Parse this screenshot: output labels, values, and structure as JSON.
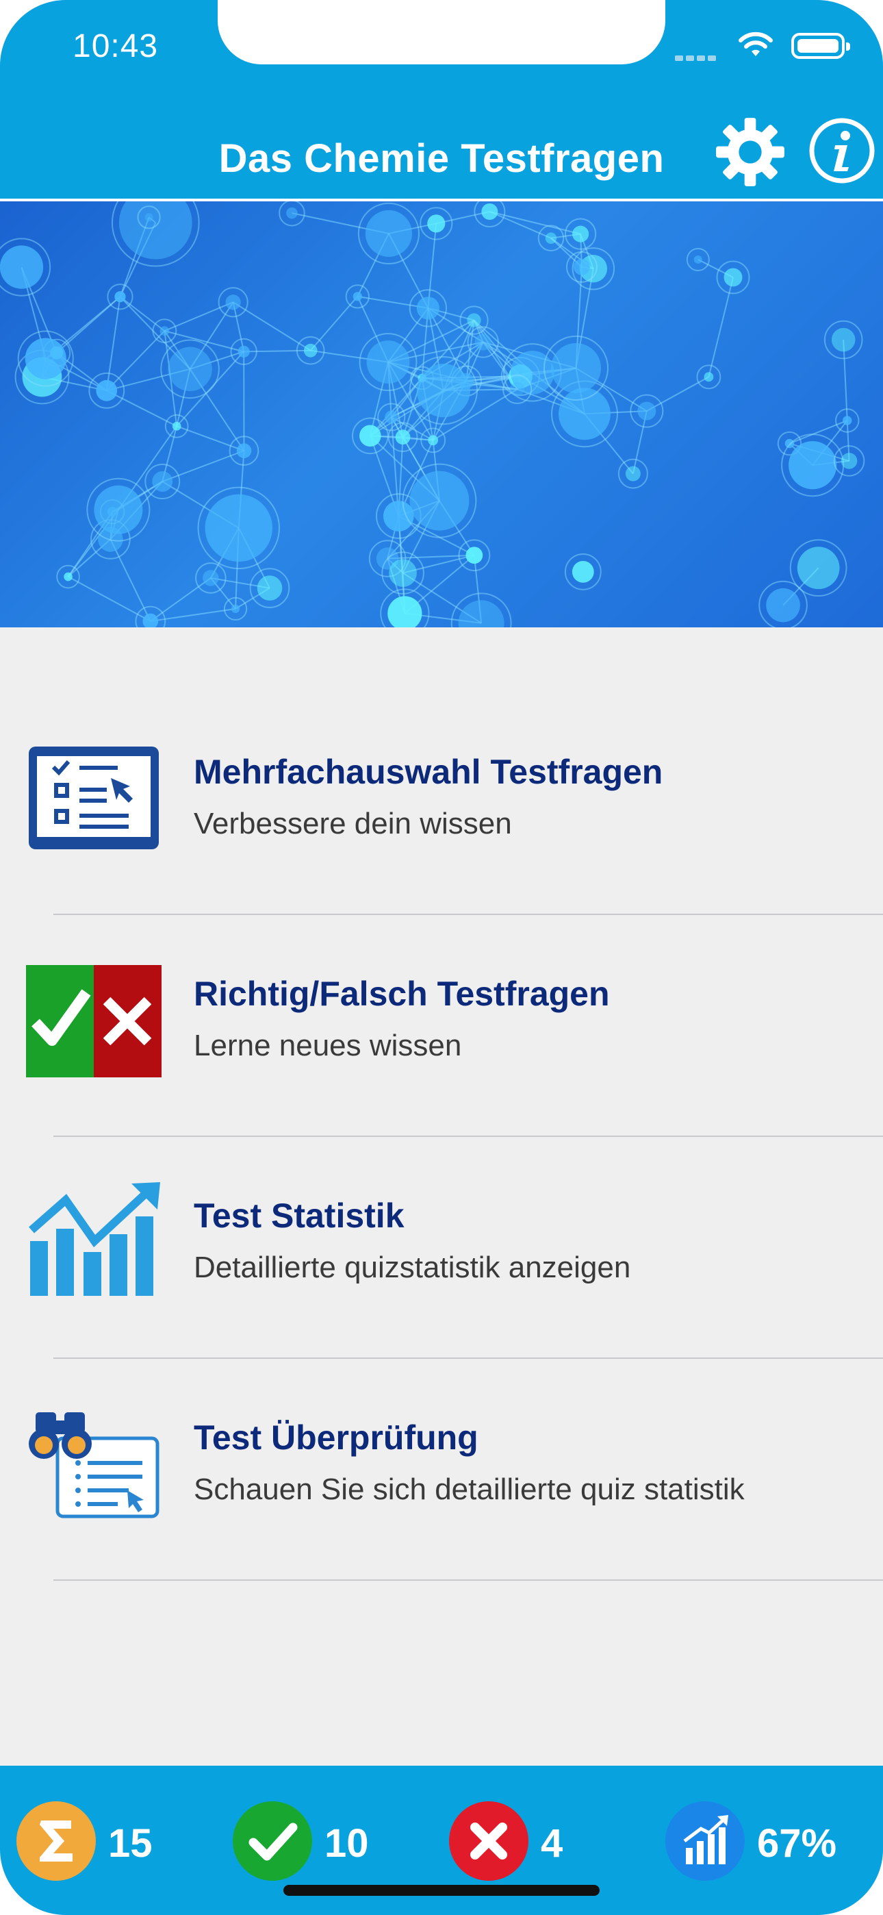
{
  "status_bar": {
    "time": "10:43"
  },
  "header": {
    "title": "Das Chemie Testfragen"
  },
  "menu": [
    {
      "title": "Mehrfachauswahl Testfragen",
      "subtitle": "Verbessere dein wissen"
    },
    {
      "title": "Richtig/Falsch Testfragen",
      "subtitle": "Lerne neues wissen"
    },
    {
      "title": "Test Statistik",
      "subtitle": "Detaillierte quizstatistik anzeigen"
    },
    {
      "title": "Test Überprüfung",
      "subtitle": "Schauen Sie sich detaillierte quiz statistik"
    }
  ],
  "stats": {
    "total": "15",
    "correct": "10",
    "wrong": "4",
    "percent": "67%"
  },
  "colors": {
    "accent": "#08a2df",
    "menu_title": "#0d2a7a",
    "correct": "#18a832",
    "wrong": "#e21b2a",
    "total": "#f2a93b",
    "percent": "#1a86e8"
  },
  "icons": [
    "gear-icon",
    "info-icon",
    "checklist-icon",
    "true-false-icon",
    "statistics-icon",
    "review-icon",
    "sigma-icon",
    "check-icon",
    "close-icon",
    "chart-icon"
  ]
}
